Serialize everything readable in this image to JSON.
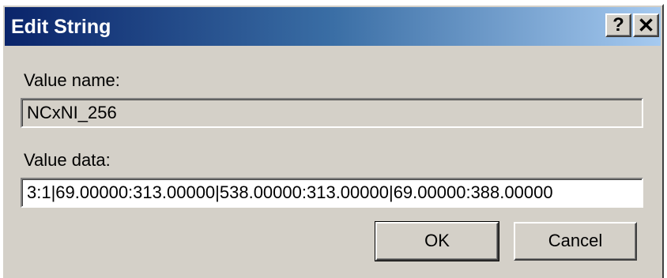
{
  "window": {
    "title": "Edit String",
    "help_label": "?",
    "close_label": "✕"
  },
  "value_name": {
    "label": "Value name:",
    "value": "NCxNI_256"
  },
  "value_data": {
    "label": "Value data:",
    "value": "3:1|69.00000:313.00000|538.00000:313.00000|69.00000:388.00000"
  },
  "buttons": {
    "ok_label": "OK",
    "cancel_label": "Cancel"
  },
  "colors": {
    "titlebar_start": "#0a246a",
    "titlebar_end": "#a6caf0",
    "dialog_face": "#d4d0c8"
  }
}
